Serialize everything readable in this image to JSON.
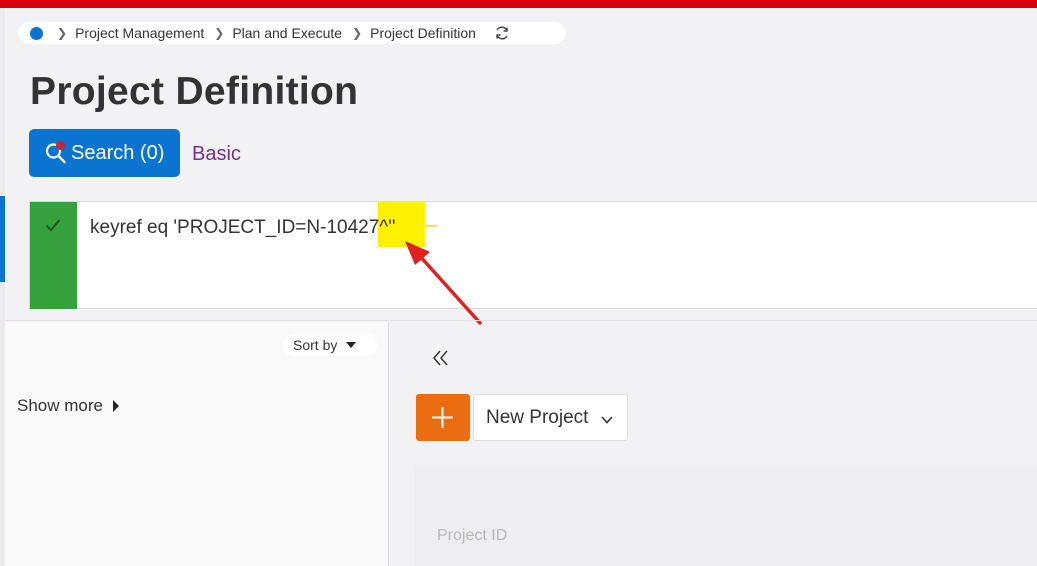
{
  "breadcrumb": {
    "items": [
      "Project Management",
      "Plan and Execute",
      "Project Definition"
    ]
  },
  "page": {
    "title": "Project Definition"
  },
  "search": {
    "label": "Search (0)",
    "basic_label": "Basic"
  },
  "filter": {
    "query": "keyref eq 'PROJECT_ID=N-10427^''"
  },
  "left_panel": {
    "sort_label": "Sort by",
    "show_more_label": "Show more"
  },
  "toolbar": {
    "new_project_label": "New Project"
  },
  "grid": {
    "column_header": "Project ID"
  },
  "colors": {
    "top_bar": "#d9000d",
    "primary": "#0b74d1",
    "success": "#36a03c",
    "add": "#ec6c10",
    "basic_link": "#7a2d8e",
    "highlight": "#fff200",
    "annotation_arrow": "#e02020"
  },
  "icons": {
    "home": "home-dot-icon",
    "separator": "chevron-right-icon",
    "refresh": "refresh-icon",
    "search": "search-icon",
    "check": "check-icon",
    "sort": "caret-down-icon",
    "show_more": "caret-right-icon",
    "collapse": "double-chevron-left-icon",
    "add": "plus-icon",
    "dropdown": "chevron-down-icon"
  }
}
